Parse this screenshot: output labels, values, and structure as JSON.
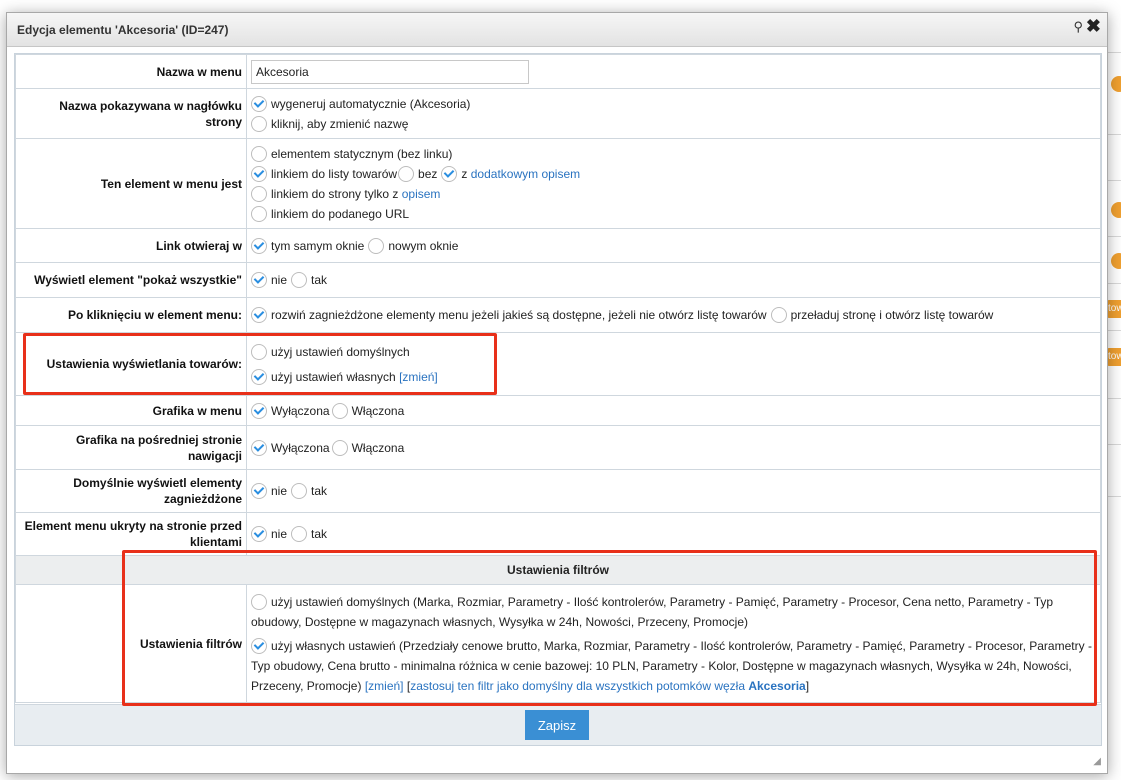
{
  "dialog": {
    "title": "Edycja elementu 'Akcesoria' (ID=247)",
    "pin_icon": "⚲",
    "close_icon": "✖"
  },
  "fields": {
    "menu_name": {
      "label": "Nazwa w menu",
      "value": "Akcesoria"
    },
    "header_name": {
      "label": "Nazwa pokazywana w nagłówku strony",
      "options": [
        "wygeneruj automatycznie (Akcesoria)",
        "kliknij, aby zmienić nazwę"
      ],
      "selected": 0
    },
    "element_type": {
      "label": "Ten element w menu jest",
      "opt1": "elementem statycznym (bez linku)",
      "opt2": "linkiem do listy towarów",
      "opt2_without": "bez",
      "opt2_with": "z",
      "opt2_with_link": "dodatkowym opisem",
      "opt3": "linkiem do strony tylko z",
      "opt3_link": "opisem",
      "opt4": "linkiem do podanego URL"
    },
    "link_open": {
      "label": "Link otwieraj w",
      "options": [
        "tym samym oknie",
        "nowym oknie"
      ],
      "selected": 0
    },
    "show_all": {
      "label": "Wyświetl element \"pokaż wszystkie\"",
      "options": [
        "nie",
        "tak"
      ],
      "selected": 0
    },
    "on_click": {
      "label": "Po kliknięciu w element menu:",
      "options": [
        "rozwiń zagnieżdżone elementy menu jeżeli jakieś są dostępne, jeżeli nie otwórz listę towarów",
        "przeładuj stronę i otwórz listę towarów"
      ],
      "selected": 0
    },
    "product_display": {
      "label": "Ustawienia wyświetlania towarów:",
      "opt1": "użyj ustawień domyślnych",
      "opt2": "użyj ustawień własnych",
      "change_link": "[zmień]"
    },
    "menu_graphic": {
      "label": "Grafika w menu",
      "options": [
        "Wyłączona",
        "Włączona"
      ],
      "selected": 0
    },
    "intermediate_graphic": {
      "label": "Grafika na pośredniej stronie nawigacji",
      "options": [
        "Wyłączona",
        "Włączona"
      ],
      "selected": 0
    },
    "default_nested": {
      "label": "Domyślnie wyświetl elementy zagnieżdżone",
      "options": [
        "nie",
        "tak"
      ],
      "selected": 0
    },
    "hidden": {
      "label": "Element menu ukryty na stronie przed klientami",
      "options": [
        "nie",
        "tak"
      ],
      "selected": 0
    }
  },
  "filters": {
    "section_title": "Ustawienia filtrów",
    "label": "Ustawienia filtrów",
    "opt1": "użyj ustawień domyślnych (Marka, Rozmiar, Parametry - Ilość kontrolerów, Parametry - Pamięć, Parametry - Procesor, Cena netto, Parametry - Typ obudowy, Dostępne w magazynach własnych, Wysyłka w 24h, Nowości, Przeceny, Promocje)",
    "opt2": "użyj własnych ustawień (Przedziały cenowe brutto, Marka, Rozmiar, Parametry - Ilość kontrolerów, Parametry - Pamięć, Parametry - Procesor, Parametry - Typ obudowy, Cena brutto - minimalna różnica w cenie bazowej: 10 PLN, Parametry - Kolor, Dostępne w magazynach własnych, Wysyłka w 24h, Nowości, Przeceny, Promocje)",
    "change_link": "[zmień]",
    "apply_bracket_open": "[",
    "apply_link": "zastosuj ten filtr jako domyślny dla wszystkich potomków węzła",
    "apply_node": "Akcesoria",
    "apply_bracket_close": "]"
  },
  "save_button": "Zapisz",
  "background": {
    "tag1": "tow",
    "tag2": "tow"
  },
  "colors": {
    "accent": "#3a8fd4",
    "highlight": "#e8301a",
    "link": "#2a73c0",
    "badge": "#f0a030"
  }
}
